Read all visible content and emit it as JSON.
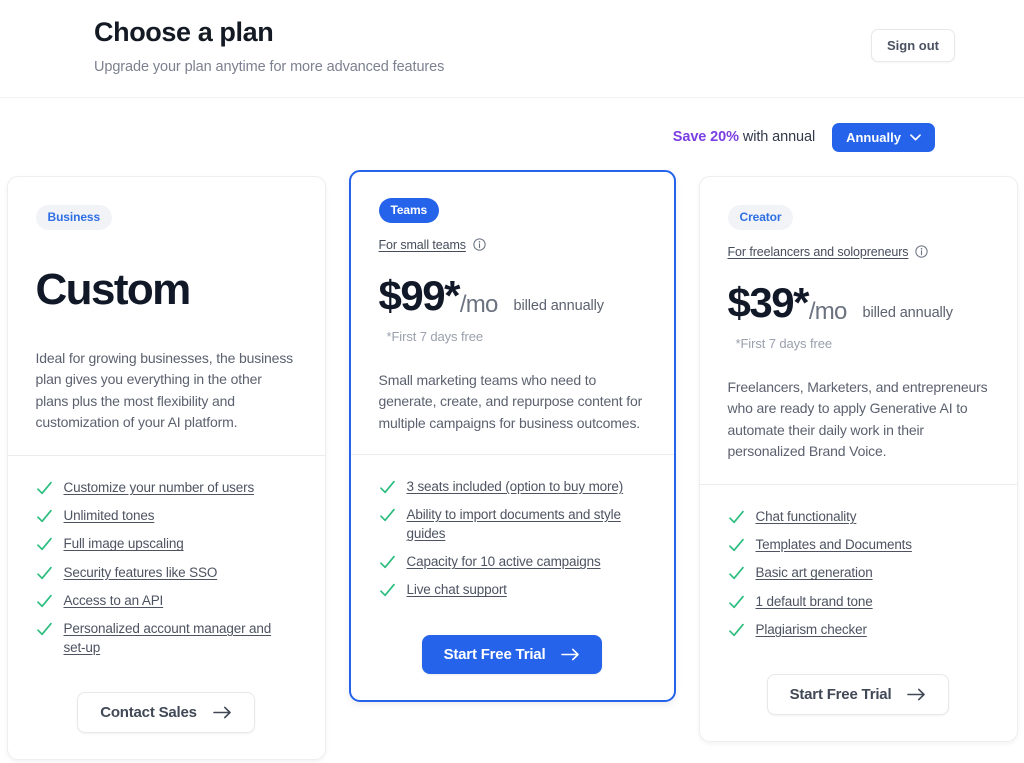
{
  "header": {
    "title": "Choose a plan",
    "subtitle": "Upgrade your plan anytime for more advanced features",
    "signout_label": "Sign out"
  },
  "billing": {
    "save_highlight": "Save 20%",
    "save_rest": " with annual",
    "selected_option": "Annually",
    "chevron_icon": "chevron-down-icon"
  },
  "colors": {
    "accent_blue": "#2563eb",
    "save_purple": "#7b3fe4",
    "check_green": "#2bbd7e",
    "badge_bg": "#f1f3f7",
    "badge_text": "#2f6fe4"
  },
  "cards": [
    {
      "id": "business",
      "badge": "Business",
      "badge_style": "soft",
      "featured": false,
      "headline": "Custom",
      "description": "Ideal for growing businesses, the business plan gives you everything in the other plans plus the most flexibility and customization of your AI platform.",
      "features": [
        "Customize your number of users",
        "Unlimited tones",
        "Full image upscaling",
        "Security features like SSO",
        "Access to an API",
        "Personalized account manager and set-up"
      ],
      "cta_label": "Contact Sales",
      "cta_style": "outline",
      "cta_icon": "arrow-right-icon"
    },
    {
      "id": "teams",
      "badge": "Teams",
      "badge_style": "solid",
      "featured": true,
      "tagline": "For small teams",
      "tagline_icon": "info-circle-icon",
      "price_amount": "$99*",
      "price_period": "/mo",
      "price_billing": "billed annually",
      "price_note": "*First 7 days free",
      "description": "Small marketing teams who need to generate, create, and repurpose content for multiple campaigns for business outcomes.",
      "features": [
        "3 seats included (option to buy more)",
        "Ability to import documents and style guides",
        "Capacity for 10 active campaigns",
        "Live chat support"
      ],
      "cta_label": "Start Free Trial",
      "cta_style": "primary",
      "cta_icon": "arrow-right-icon"
    },
    {
      "id": "creator",
      "badge": "Creator",
      "badge_style": "soft",
      "featured": false,
      "tagline": "For freelancers and solopreneurs",
      "tagline_icon": "info-circle-icon",
      "price_amount": "$39*",
      "price_period": "/mo",
      "price_billing": "billed annually",
      "price_note": "*First 7 days free",
      "description": "Freelancers, Marketers, and entrepreneurs who are ready to apply Generative AI to automate their daily work in their personalized Brand Voice.",
      "features": [
        "Chat functionality",
        "Templates and Documents",
        "Basic art generation",
        "1 default brand tone",
        "Plagiarism checker"
      ],
      "cta_label": "Start Free Trial",
      "cta_style": "outline",
      "cta_icon": "arrow-right-icon"
    }
  ]
}
